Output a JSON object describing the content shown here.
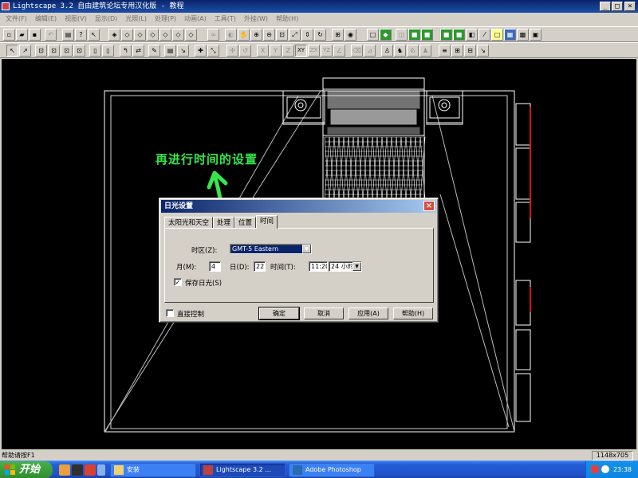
{
  "window": {
    "title": "Lightscape 3.2 自由建筑论坛专用汉化版  - 教程",
    "minimize_glyph": "_",
    "maximize_glyph": "□",
    "close_glyph": "×"
  },
  "menu": [
    "文件(F)",
    "编辑(E)",
    "视图(V)",
    "显示(D)",
    "光照(L)",
    "处理(P)",
    "动画(A)",
    "工具(T)",
    "外挂(W)",
    "帮助(H)"
  ],
  "toolbar_axes": [
    "X",
    "Y",
    "Z",
    "XY",
    "ZX",
    "YZ"
  ],
  "annotation": {
    "text": "再进行时间的设置",
    "color": "#36e64a"
  },
  "dialog": {
    "title": "日光设置",
    "close_glyph": "×",
    "tabs": [
      "太阳光和天空",
      "处理",
      "位置",
      "时间"
    ],
    "active_tab": "时间",
    "timezone_label": "时区(Z):",
    "timezone_value": "GMT-5   Eastern",
    "month_label": "月(M):",
    "month_value": "4",
    "day_label": "日(D):",
    "day_value": "22",
    "time_label": "时间(T):",
    "time_value": "11:20",
    "format_value": "24 小时",
    "save_daylight_label": "保存日光(S)",
    "save_daylight_checked": true,
    "direct_control_label": "直接控制",
    "direct_control_checked": false,
    "ok_button": "确定",
    "cancel_button": "取消",
    "apply_button": "应用(A)",
    "help_button": "帮助(H)"
  },
  "status": {
    "text": "帮助请按F1",
    "resolution": "1148x705"
  },
  "taskbar": {
    "start_label": "开始",
    "tasks": [
      {
        "label": "安装",
        "icon": "folder-icon"
      },
      {
        "label": "Lightscape 3.2 ...",
        "icon": "lightscape-icon"
      },
      {
        "label": "Adobe Photoshop",
        "icon": "photoshop-icon"
      }
    ],
    "clock": "23:38"
  },
  "colors": {
    "title_bar": "#0a246a",
    "taskbar": "#245dd7",
    "start_button": "#3a9a3a",
    "viewport_background": "#000000",
    "wireframe": "#ffffff",
    "red_accent": "#e01010"
  }
}
